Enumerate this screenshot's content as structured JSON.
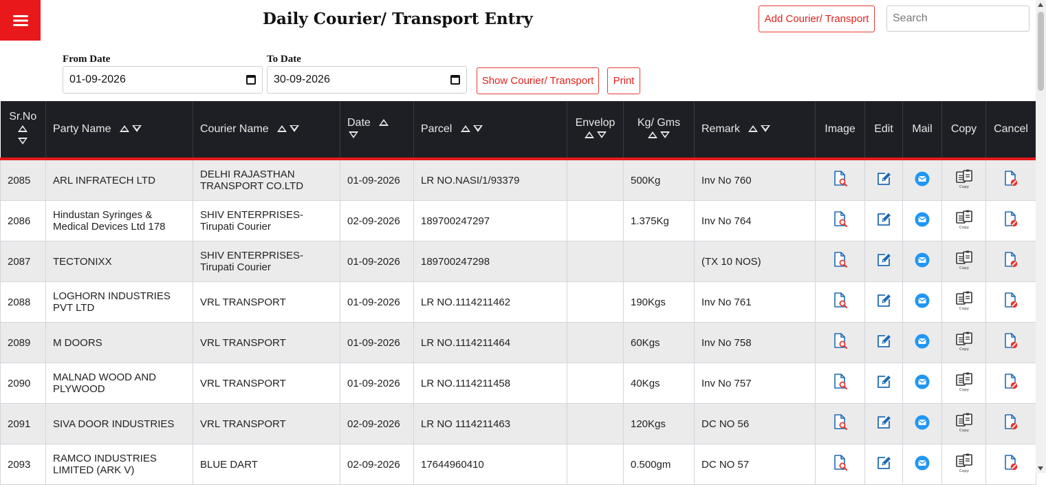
{
  "header": {
    "title": "Daily Courier/ Transport Entry",
    "add_button": "Add Courier/ Transport",
    "search_placeholder": "Search"
  },
  "filters": {
    "from_label": "From Date",
    "from_value": "01-09-2026",
    "to_label": "To Date",
    "to_value": "30-09-2026",
    "show_button": "Show Courier/ Transport",
    "print_button": "Print"
  },
  "table": {
    "columns": {
      "srno": "Sr.No",
      "party": "Party Name",
      "courier": "Courier Name",
      "date": "Date",
      "parcel": "Parcel",
      "envelop": "Envelop",
      "kg": "Kg/ Gms",
      "remark": "Remark",
      "image": "Image",
      "edit": "Edit",
      "mail": "Mail",
      "copy": "Copy",
      "cancel": "Cancel"
    },
    "copy_icon_caption": "Copy",
    "rows": [
      {
        "srno": "2085",
        "party": "ARL INFRATECH LTD",
        "courier": "DELHI RAJASTHAN TRANSPORT CO.LTD",
        "date": "01-09-2026",
        "parcel": "LR NO.NASI/1/93379",
        "envelop": "",
        "kg": "500Kg",
        "remark": "Inv No 760"
      },
      {
        "srno": "2086",
        "party": "Hindustan Syringes & Medical Devices Ltd 178",
        "courier": "SHIV ENTERPRISES-Tirupati Courier",
        "date": "02-09-2026",
        "parcel": "189700247297",
        "envelop": "",
        "kg": "1.375Kg",
        "remark": "Inv No 764"
      },
      {
        "srno": "2087",
        "party": "TECTONIXX",
        "courier": "SHIV ENTERPRISES-Tirupati Courier",
        "date": "01-09-2026",
        "parcel": "189700247298",
        "envelop": "",
        "kg": "",
        "remark": "(TX 10 NOS)"
      },
      {
        "srno": "2088",
        "party": "LOGHORN INDUSTRIES PVT LTD",
        "courier": "VRL TRANSPORT",
        "date": "01-09-2026",
        "parcel": "LR NO.1114211462",
        "envelop": "",
        "kg": "190Kgs",
        "remark": "Inv No 761"
      },
      {
        "srno": "2089",
        "party": "M DOORS",
        "courier": "VRL TRANSPORT",
        "date": "01-09-2026",
        "parcel": "LR NO.1114211464",
        "envelop": "",
        "kg": "60Kgs",
        "remark": "Inv No 758"
      },
      {
        "srno": "2090",
        "party": "MALNAD WOOD AND PLYWOOD",
        "courier": "VRL TRANSPORT",
        "date": "01-09-2026",
        "parcel": "LR NO.1114211458",
        "envelop": "",
        "kg": "40Kgs",
        "remark": "Inv No 757"
      },
      {
        "srno": "2091",
        "party": "SIVA DOOR INDUSTRIES",
        "courier": "VRL TRANSPORT",
        "date": "02-09-2026",
        "parcel": "LR NO 1114211463",
        "envelop": "",
        "kg": "120Kgs",
        "remark": "DC NO 56"
      },
      {
        "srno": "2093",
        "party": "RAMCO INDUSTRIES LIMITED (ARK V)",
        "courier": "BLUE DART",
        "date": "02-09-2026",
        "parcel": "17644960410",
        "envelop": "",
        "kg": "0.500gm",
        "remark": "DC NO 57"
      }
    ]
  },
  "colors": {
    "accent": "#e8181b",
    "header_bg": "#1e1f24",
    "icon_blue": "#1e6ab4",
    "mail_blue": "#2196f3",
    "cancel_red": "#e53935"
  },
  "icons": {
    "menu": "hamburger-icon",
    "calendar": "calendar-icon",
    "image": "document-search-icon",
    "edit": "edit-icon",
    "mail": "mail-icon",
    "copy": "copy-icon",
    "cancel": "document-cancel-icon"
  }
}
